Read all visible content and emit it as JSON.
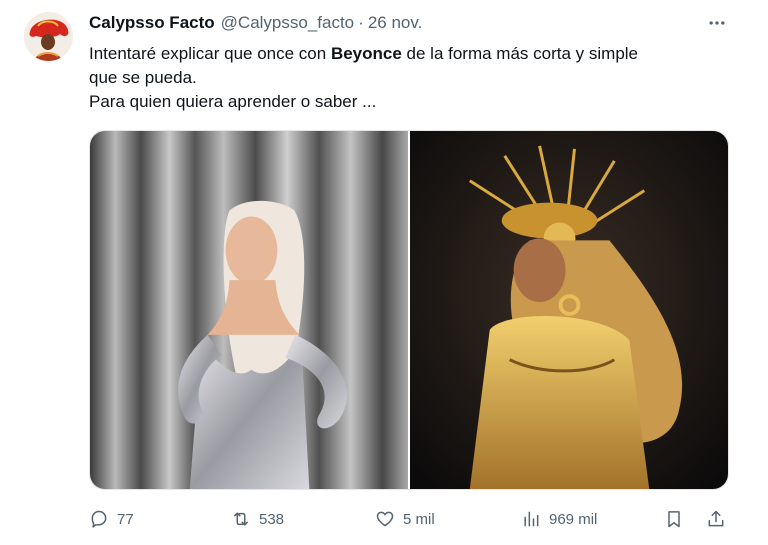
{
  "tweet": {
    "author_name": "Calypsso Facto",
    "author_handle": "@Calypsso_facto",
    "separator": "·",
    "date": "26 nov.",
    "text_line1_prefix": "Intentaré explicar que once con ",
    "text_line1_bold": "Beyonce",
    "text_line1_suffix": " de la forma más corta y simple",
    "text_line2": "que se pueda.",
    "text_line3": "Para quien quiera aprender o saber ...",
    "more_icon": "ellipsis-icon"
  },
  "actions": {
    "replies": "77",
    "retweets": "538",
    "likes": "5 mil",
    "views": "969 mil",
    "icons": [
      "reply-icon",
      "retweet-icon",
      "heart-icon",
      "views-icon",
      "bookmark-icon",
      "share-icon"
    ]
  },
  "colors": {
    "text": "#0f1419",
    "secondary": "#536471",
    "avatar_red": "#d7261e"
  }
}
